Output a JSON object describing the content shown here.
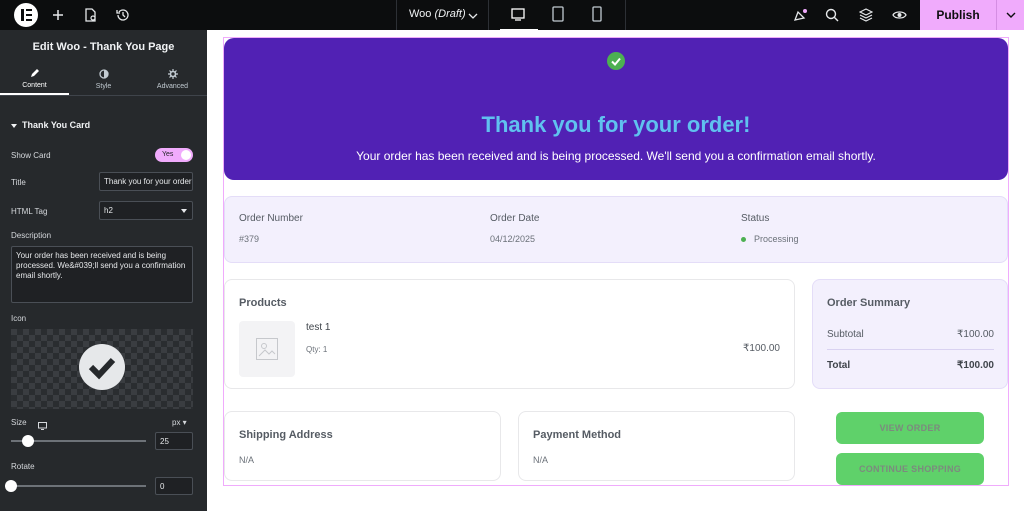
{
  "topbar": {
    "doc_title": "Woo",
    "doc_status": "(Draft)",
    "publish_label": "Publish",
    "accent": "#f0abfc"
  },
  "panel": {
    "title": "Edit Woo - Thank You Page",
    "tabs": [
      {
        "label": "Content",
        "icon": "pencil-icon"
      },
      {
        "label": "Style",
        "icon": "half-circle-icon"
      },
      {
        "label": "Advanced",
        "icon": "gear-icon"
      }
    ],
    "section": "Thank You Card",
    "show_card_label": "Show Card",
    "show_card_value": "Yes",
    "title_label": "Title",
    "title_value": "Thank you for your order!",
    "html_tag_label": "HTML Tag",
    "html_tag_value": "h2",
    "description_label": "Description",
    "description_value": "Your order has been received and is being processed. We&#039;ll send you a confirmation email shortly.",
    "icon_label": "Icon",
    "size_label": "Size",
    "size_unit": "px",
    "size_value": "25",
    "rotate_label": "Rotate",
    "rotate_value": "0"
  },
  "page": {
    "hero_title": "Thank you for your order!",
    "hero_description": "Your order has been received and is being processed. We'll send you a confirmation email shortly.",
    "hero_color": "#5121b4",
    "order_number_label": "Order Number",
    "order_number": "#379",
    "order_date_label": "Order Date",
    "order_date": "04/12/2025",
    "status_label": "Status",
    "status": "Processing",
    "products_heading": "Products",
    "product_name": "test 1",
    "product_qty": "Qty: 1",
    "product_price": "₹100.00",
    "summary_heading": "Order Summary",
    "subtotal_label": "Subtotal",
    "subtotal_value": "₹100.00",
    "total_label": "Total",
    "total_value": "₹100.00",
    "shipping_heading": "Shipping Address",
    "shipping_value": "N/A",
    "payment_heading": "Payment Method",
    "payment_value": "N/A",
    "view_order_label": "VIEW ORDER",
    "continue_label": "CONTINUE SHOPPING",
    "button_color": "#5fd16a"
  }
}
